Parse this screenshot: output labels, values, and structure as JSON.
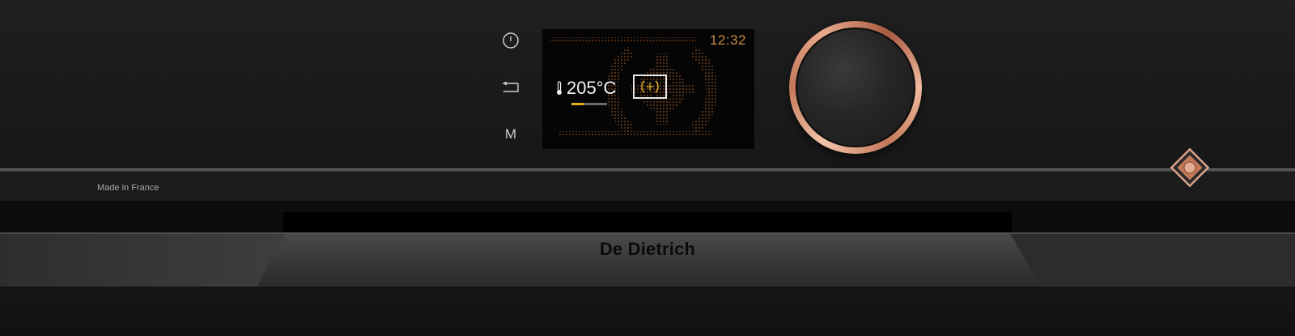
{
  "display": {
    "clock": "12:32",
    "temperature": "205°C",
    "mode_icon": "fan-heat-icon",
    "progress_fraction": 0.35
  },
  "controls": {
    "power_icon": "power-icon",
    "back_icon": "back-arrow-icon",
    "menu_label": "M",
    "knob_icon": "rotary-knob"
  },
  "panel": {
    "made_in": "Made in France"
  },
  "brand": {
    "name": "De Dietrich",
    "emblem": "diamond-logo-icon"
  },
  "colors": {
    "accent_copper": "#c4785a",
    "display_orange": "#c88a46",
    "indicator_yellow": "#e0b020",
    "body_black": "#1a1a1a"
  }
}
